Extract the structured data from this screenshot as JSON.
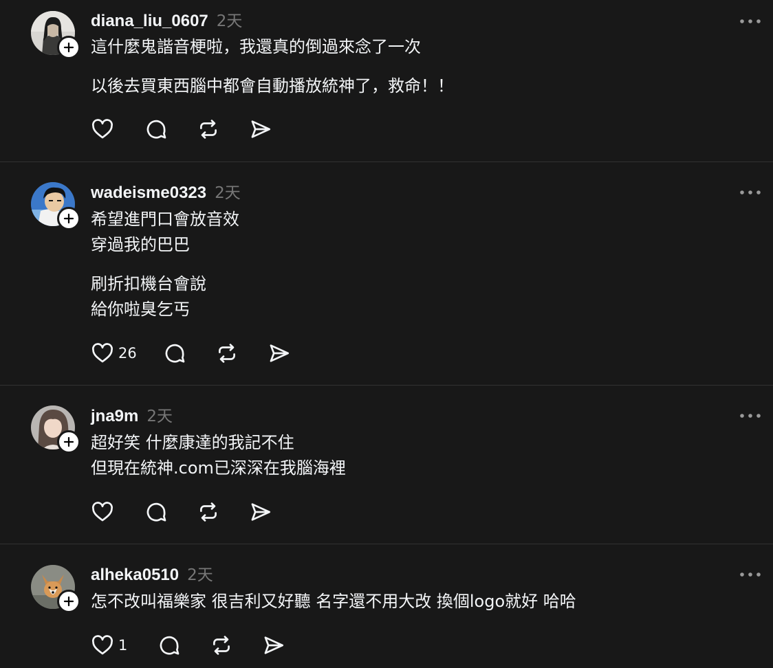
{
  "posts": [
    {
      "username": "diana_liu_0607",
      "time": "2天",
      "paragraphs": [
        [
          "這什麼鬼諧音梗啦，我還真的倒過來念了一次"
        ],
        [
          "以後去買東西腦中都會自動播放統神了，救命！！"
        ]
      ],
      "likes": "",
      "avatar": "avatar-diana"
    },
    {
      "username": "wadeisme0323",
      "time": "2天",
      "paragraphs": [
        [
          "希望進門口會放音效",
          "穿過我的巴巴"
        ],
        [
          "刷折扣機台會說",
          "給你啦臭乞丐"
        ]
      ],
      "likes": "26",
      "avatar": "avatar-wade"
    },
    {
      "username": "jna9m",
      "time": "2天",
      "paragraphs": [
        [
          "超好笑 什麼康達的我記不住",
          "但現在統神.com已深深在我腦海裡"
        ]
      ],
      "likes": "",
      "avatar": "avatar-jna"
    },
    {
      "username": "alheka0510",
      "time": "2天",
      "paragraphs": [
        [
          "怎不改叫福樂家 很吉利又好聽 名字還不用大改 換個logo就好 哈哈"
        ]
      ],
      "likes": "1",
      "avatar": "avatar-alheka"
    }
  ],
  "icons": {
    "like": "heart-icon",
    "reply": "comment-icon",
    "repost": "repost-icon",
    "share": "send-icon",
    "more": "more-horizontal-icon",
    "follow": "plus-icon"
  },
  "colors": {
    "background": "#181818",
    "text": "#f3f5f7",
    "secondary": "#777777",
    "divider": "#323232"
  }
}
